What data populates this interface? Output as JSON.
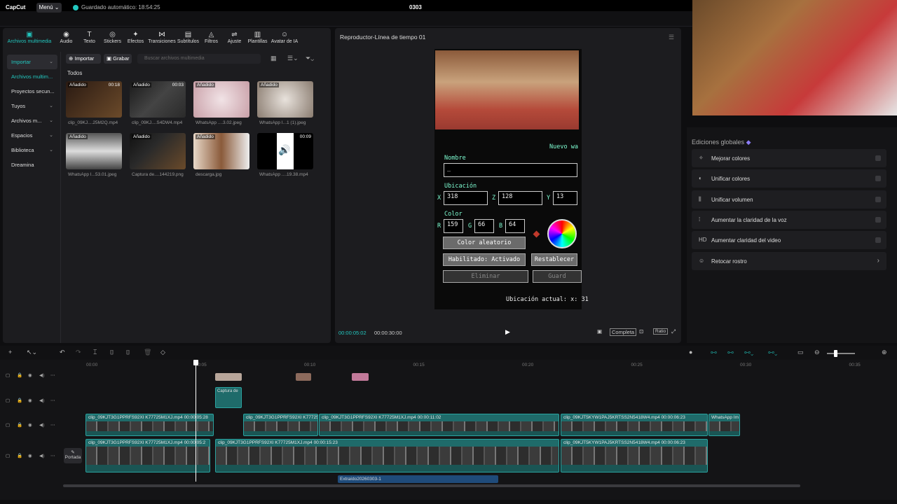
{
  "app": {
    "logo": "CapCut",
    "menu": "Menú ⌄",
    "autosave": "Guardado automático: 18:54:25",
    "project": "0303"
  },
  "toolbar": [
    {
      "label": "Archivos multimedia",
      "icon": "media-icon"
    },
    {
      "label": "Audio",
      "icon": "audio-icon"
    },
    {
      "label": "Texto",
      "icon": "text-icon"
    },
    {
      "label": "Stickers",
      "icon": "sticker-icon"
    },
    {
      "label": "Efectos",
      "icon": "effects-icon"
    },
    {
      "label": "Transiciones",
      "icon": "transitions-icon"
    },
    {
      "label": "Subtítulos",
      "icon": "subtitles-icon"
    },
    {
      "label": "Filtros",
      "icon": "filters-icon"
    },
    {
      "label": "Ajuste",
      "icon": "adjust-icon"
    },
    {
      "label": "Plantillas",
      "icon": "templates-icon"
    },
    {
      "label": "Avatar de IA",
      "icon": "ai-avatar-icon"
    }
  ],
  "sidebar": [
    {
      "label": "Importar",
      "chev": "⌄"
    },
    {
      "label": "Archivos multim..."
    },
    {
      "label": "Proyectos secun..."
    },
    {
      "label": "Tuyos",
      "chev": "⌄"
    },
    {
      "label": "Archivos m...",
      "chev": "⌄"
    },
    {
      "label": "Espacios",
      "chev": "⌄"
    },
    {
      "label": "Biblioteca",
      "chev": "⌄"
    },
    {
      "label": "Dreamina"
    }
  ],
  "media": {
    "import": "Importar",
    "record": "Grabar",
    "search_placeholder": "Buscar archivos multimedia",
    "all": "Todos",
    "items": [
      {
        "badge": "Añadido",
        "dur": "00:18",
        "caption": "clip_09KJ....25M2Q.mp4"
      },
      {
        "badge": "Añadido",
        "dur": "00:03",
        "caption": "clip_09KJ....S4DW4.mp4"
      },
      {
        "badge": "Añadido",
        "dur": "",
        "caption": "WhatsApp ....3.02.jpeg"
      },
      {
        "badge": "Añadido",
        "dur": "",
        "caption": "WhatsApp I...1 (1).jpeg"
      },
      {
        "badge": "Añadido",
        "dur": "",
        "caption": "WhatsApp I...53.01.jpeg"
      },
      {
        "badge": "Añadido",
        "dur": "",
        "caption": "Captura de....144219.png"
      },
      {
        "badge": "Añadido",
        "dur": "",
        "caption": "descarga.jpg"
      },
      {
        "badge": "",
        "dur": "00:09",
        "caption": "WhatsApp ....19.38.mp4"
      }
    ]
  },
  "player": {
    "title": "Reproductor-Línea de tiempo 01",
    "current": "00:00:05:02",
    "total": "00:00:30:00",
    "complete": "Completa",
    "ratio": "Ratio"
  },
  "game": {
    "new_way": "Nuevo wa",
    "name_label": "Nombre",
    "name_value": "_",
    "location_label": "Ubicación",
    "x_label": "X",
    "x": "318",
    "z_label": "Z",
    "z": "128",
    "y_label": "Y",
    "y": "13",
    "color_label": "Color",
    "r_label": "R",
    "r": "159",
    "g_label": "G",
    "g": "66",
    "b_label": "B",
    "b": "64",
    "random_color": "Color aleatorio",
    "enabled": "Habilitado: Activado",
    "reset": "Restablecer",
    "delete": "Eliminar",
    "save": "Guard",
    "current_loc": "Ubicación actual: x: 31"
  },
  "global_edits": {
    "title": "Ediciones globales",
    "items": [
      {
        "label": "Mejorar colores",
        "icon": "magic-wand-icon"
      },
      {
        "label": "Unificar colores",
        "icon": "palette-icon"
      },
      {
        "label": "Unificar volumen",
        "icon": "volume-bars-icon"
      },
      {
        "label": "Aumentar la claridad de la voz",
        "icon": "voice-icon"
      },
      {
        "label": "Aumentar claridad del video",
        "icon": "hd-icon"
      },
      {
        "label": "Retocar rostro",
        "icon": "face-icon",
        "chev": "›"
      }
    ]
  },
  "timeline": {
    "ticks": [
      "00:00",
      "00:05",
      "00:10",
      "00:15",
      "00:20",
      "00:25",
      "00:30",
      "00:35"
    ],
    "cover": "Portada",
    "overlay_label": "Captura de",
    "text_clip": "Extraído20260303-1",
    "clips_track3": [
      {
        "label": "clip_09KJT3G1PPRFS92XI K77725M1XJ.mp4   00:00:05:28"
      },
      {
        "label": "clip_09KJT3G1PPRFS92XI K77725"
      },
      {
        "label": "clip_09KJT3G1PPRFS92XI K77725M1XJ.mp4   00:00:11:02"
      },
      {
        "label": "clip_09KJT5KYW1PAJ5KRTSS2N5418W4.mp4   00:00:06:23"
      },
      {
        "label": "WhatsApp Im"
      }
    ],
    "clips_track4": [
      {
        "label": "clip_09KJT3G1PPRFS92XI K77725M1XJ.mp4   00:00:05:2"
      },
      {
        "label": "clip_09KJT3G1PPRFS92XI K77725M1XJ.mp4   00:00:15:23"
      },
      {
        "label": "clip_09KJT5KYW1PAJ5KRTSS2N5418W4.mp4   00:00:06:23"
      }
    ]
  }
}
